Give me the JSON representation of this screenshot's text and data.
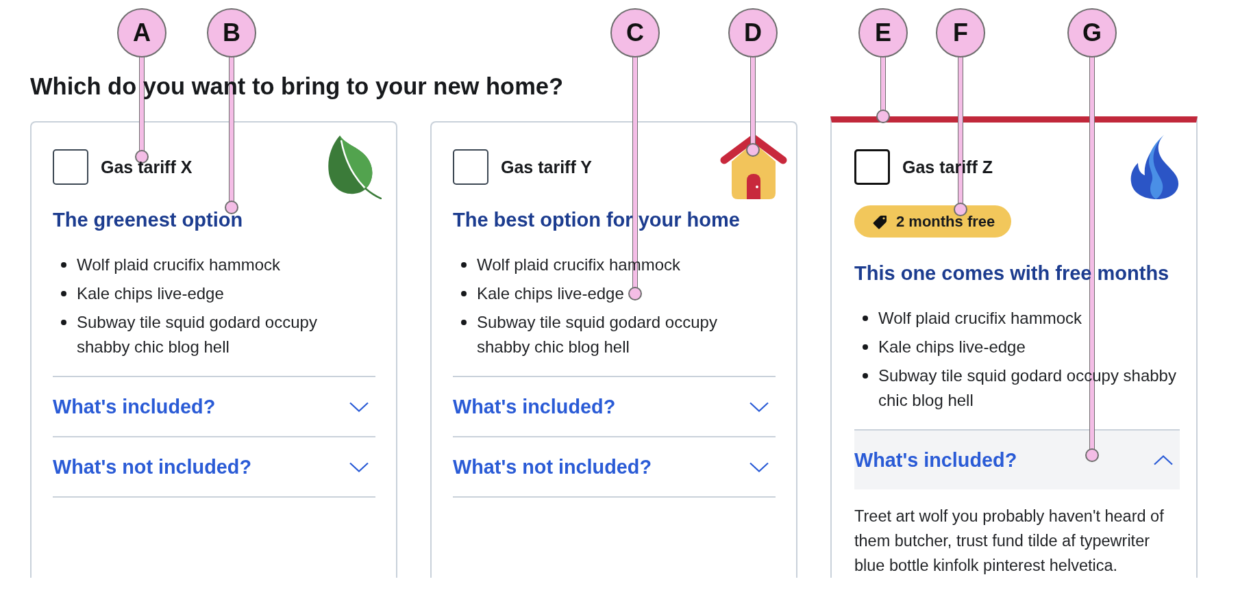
{
  "callouts": [
    {
      "label": "A"
    },
    {
      "label": "B"
    },
    {
      "label": "C"
    },
    {
      "label": "D"
    },
    {
      "label": "E"
    },
    {
      "label": "F"
    },
    {
      "label": "G"
    }
  ],
  "heading": "Which do you want to bring to your new home?",
  "cards": [
    {
      "name": "Gas tariff X",
      "checked": false,
      "highlighted": false,
      "title": "The greenest option",
      "features": [
        "Wolf plaid crucifix hammock",
        "Kale chips live-edge",
        "Subway tile squid godard occupy shabby chic blog hell"
      ],
      "sections": [
        {
          "title": "What's included?",
          "expanded": false
        },
        {
          "title": "What's not included?",
          "expanded": false
        }
      ]
    },
    {
      "name": "Gas tariff Y",
      "checked": false,
      "highlighted": false,
      "title": "The best option for your home",
      "features": [
        "Wolf plaid crucifix hammock",
        "Kale chips live-edge",
        "Subway tile squid godard occupy shabby chic blog hell"
      ],
      "sections": [
        {
          "title": "What's included?",
          "expanded": false
        },
        {
          "title": "What's not included?",
          "expanded": false
        }
      ]
    },
    {
      "name": "Gas tariff Z",
      "checked": false,
      "highlighted": true,
      "badge": "2 months free",
      "title": "This one comes with free months",
      "features": [
        "Wolf plaid crucifix hammock",
        "Kale chips live-edge",
        "Subway tile squid godard occupy shabby chic blog hell"
      ],
      "sections": [
        {
          "title": "What's included?",
          "expanded": true,
          "body": "Treet art wolf you probably haven't heard of them butcher, trust fund tilde af typewriter blue bottle kinfolk pinterest helvetica."
        }
      ]
    }
  ]
}
